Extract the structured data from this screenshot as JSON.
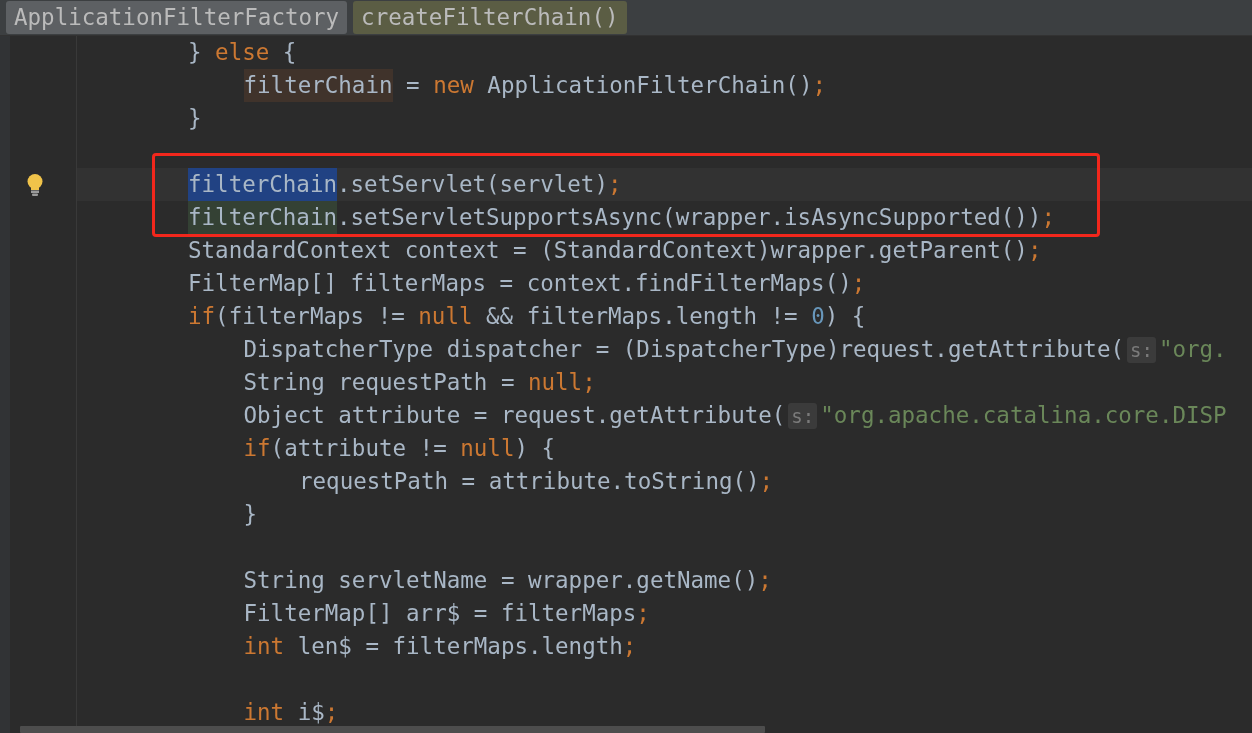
{
  "breadcrumbs": [
    {
      "label": "ApplicationFilterFactory",
      "selected": false
    },
    {
      "label": "createFilterChain()",
      "selected": true
    }
  ],
  "lines": [
    {
      "kind": "code",
      "tokens": [
        {
          "text": "} ",
          "kind": "code"
        },
        {
          "text": "else",
          "kind": "keyword"
        },
        {
          "text": " {",
          "kind": "code"
        }
      ],
      "children": [
        {
          "kind": "code",
          "tokens": [
            {
              "text": "filterChain",
              "kind": "code",
              "color": "#40332b"
            },
            {
              "text": " = ",
              "kind": "code"
            },
            {
              "text": "new",
              "kind": "keyword"
            },
            {
              "text": " ApplicationFilterChain()",
              "kind": "code"
            },
            {
              "text": ";",
              "kind": "punct"
            }
          ]
        }
      ]
    },
    {
      "kind": "code",
      "tokens": [
        {
          "text": "}",
          "kind": "code"
        }
      ]
    },
    {
      "kind": "blank"
    },
    {
      "kind": "code",
      "current": true,
      "boxed": true,
      "bulb": true,
      "tokens": [
        {
          "text": "filterChain",
          "kind": "code",
          "color": "#214283"
        },
        {
          "text": ".setServlet(servlet)",
          "kind": "code"
        },
        {
          "text": ";",
          "kind": "punct"
        }
      ]
    },
    {
      "kind": "code",
      "boxed": true,
      "tokens": [
        {
          "text": "filterChain",
          "kind": "code",
          "color": "#344134"
        },
        {
          "text": ".setServletSupportsAsync(wrapper.isAsyncSupported())",
          "kind": "code"
        },
        {
          "text": ";",
          "kind": "punct"
        }
      ]
    },
    {
      "kind": "code",
      "tokens": [
        {
          "text": "StandardContext context = (StandardContext)wrapper.getParent()",
          "kind": "code"
        },
        {
          "text": ";",
          "kind": "punct"
        }
      ]
    },
    {
      "kind": "code",
      "tokens": [
        {
          "text": "FilterMap[] filterMaps = context.findFilterMaps()",
          "kind": "code"
        },
        {
          "text": ";",
          "kind": "punct"
        }
      ]
    },
    {
      "kind": "code",
      "tokens": [
        {
          "text": "if",
          "kind": "keyword"
        },
        {
          "text": "(filterMaps != ",
          "kind": "code"
        },
        {
          "text": "null",
          "kind": "keyword"
        },
        {
          "text": " && filterMaps.length != ",
          "kind": "code"
        },
        {
          "text": "0",
          "kind": "number"
        },
        {
          "text": ") {",
          "kind": "code"
        }
      ],
      "children": [
        {
          "kind": "code",
          "tokens": [
            {
              "text": "DispatcherType dispatcher = (DispatcherType)request.getAttribute(",
              "kind": "code"
            },
            {
              "text": "s:",
              "kind": "hint"
            },
            {
              "text": "\"org.",
              "kind": "string"
            }
          ]
        },
        {
          "kind": "code",
          "tokens": [
            {
              "text": "String requestPath = ",
              "kind": "code"
            },
            {
              "text": "null",
              "kind": "keyword"
            },
            {
              "text": ";",
              "kind": "punct"
            }
          ]
        },
        {
          "kind": "code",
          "tokens": [
            {
              "text": "Object attribute = request.getAttribute(",
              "kind": "code"
            },
            {
              "text": "s:",
              "kind": "hint"
            },
            {
              "text": "\"org.apache.catalina.core.DISP",
              "kind": "string"
            }
          ]
        },
        {
          "kind": "code",
          "tokens": [
            {
              "text": "if",
              "kind": "keyword"
            },
            {
              "text": "(attribute != ",
              "kind": "code"
            },
            {
              "text": "null",
              "kind": "keyword"
            },
            {
              "text": ") {",
              "kind": "code"
            }
          ],
          "children": [
            {
              "kind": "code",
              "tokens": [
                {
                  "text": "requestPath = attribute.toString()",
                  "kind": "code"
                },
                {
                  "text": ";",
                  "kind": "punct"
                }
              ]
            }
          ]
        },
        {
          "kind": "code",
          "tokens": [
            {
              "text": "}",
              "kind": "code"
            }
          ]
        },
        {
          "kind": "blank"
        },
        {
          "kind": "code",
          "tokens": [
            {
              "text": "String servletName = wrapper.getName()",
              "kind": "code"
            },
            {
              "text": ";",
              "kind": "punct"
            }
          ]
        },
        {
          "kind": "code",
          "tokens": [
            {
              "text": "FilterMap[] arr$ = filterMaps",
              "kind": "code"
            },
            {
              "text": ";",
              "kind": "punct"
            }
          ]
        },
        {
          "kind": "code",
          "tokens": [
            {
              "text": "int",
              "kind": "keyword"
            },
            {
              "text": " len$ = filterMaps.length",
              "kind": "code"
            },
            {
              "text": ";",
              "kind": "punct"
            }
          ]
        },
        {
          "kind": "blank"
        },
        {
          "kind": "code",
          "tokens": [
            {
              "text": "int",
              "kind": "keyword"
            },
            {
              "text": " i$",
              "kind": "code"
            },
            {
              "text": ";",
              "kind": "punct"
            }
          ]
        }
      ]
    }
  ]
}
